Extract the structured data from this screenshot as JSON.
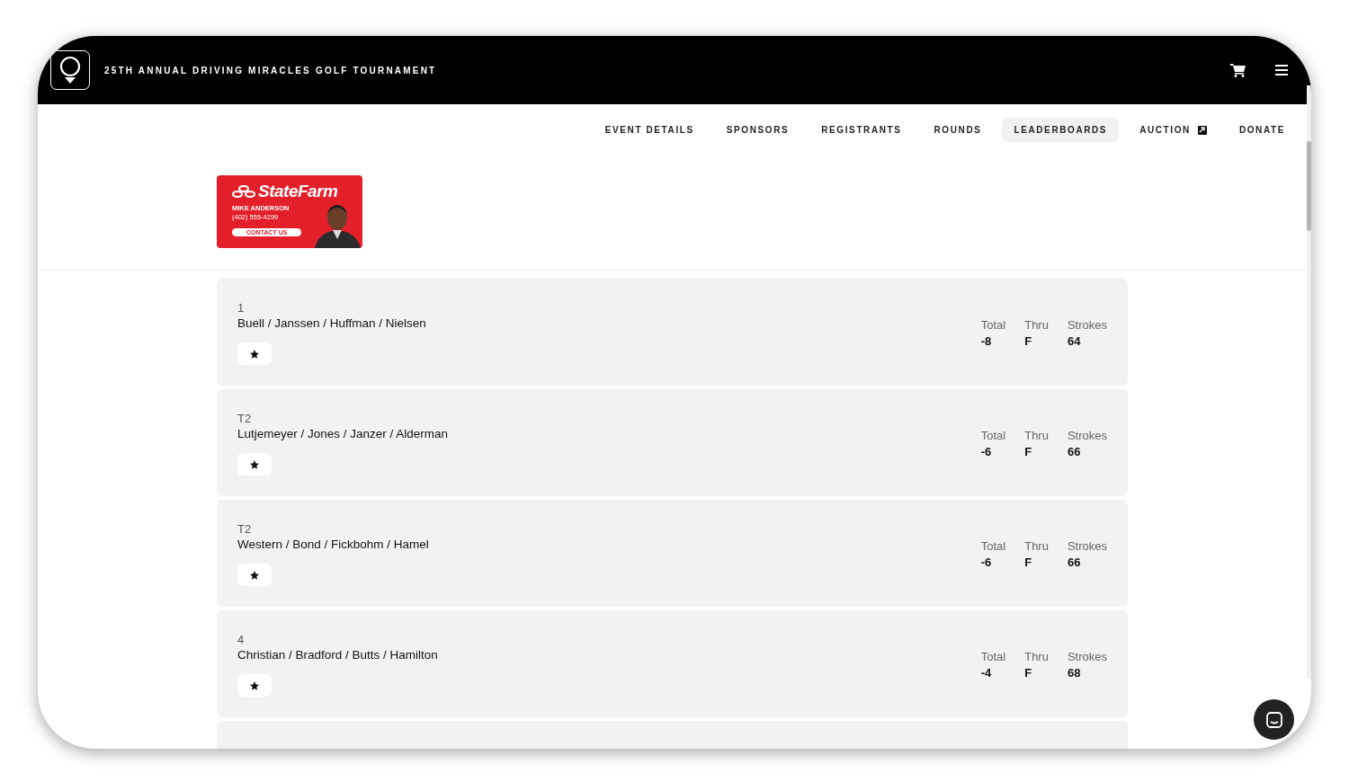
{
  "header": {
    "title": "25TH ANNUAL DRIVING MIRACLES GOLF TOURNAMENT"
  },
  "nav": [
    {
      "label": "EVENT DETAILS",
      "selected": false,
      "external": false
    },
    {
      "label": "SPONSORS",
      "selected": false,
      "external": false
    },
    {
      "label": "REGISTRANTS",
      "selected": false,
      "external": false
    },
    {
      "label": "ROUNDS",
      "selected": false,
      "external": false
    },
    {
      "label": "LEADERBOARDS",
      "selected": true,
      "external": false
    },
    {
      "label": "AUCTION",
      "selected": false,
      "external": true
    },
    {
      "label": "DONATE",
      "selected": false,
      "external": false
    }
  ],
  "sponsor_ad": {
    "brand": "StateFarm",
    "name": "MIKE ANDERSON",
    "phone": "(402) 555-4299",
    "button": "CONTACT US"
  },
  "leaderboard": [
    {
      "rank": "1",
      "team": "Buell / Janssen / Huffman / Nielsen",
      "favorite": true,
      "stats": [
        {
          "label": "Total",
          "value": "-8"
        },
        {
          "label": "Thru",
          "value": "F"
        },
        {
          "label": "Strokes",
          "value": "64"
        }
      ]
    },
    {
      "rank": "T2",
      "team": "Lutjemeyer / Jones / Janzer / Alderman",
      "favorite": true,
      "stats": [
        {
          "label": "Total",
          "value": "-6"
        },
        {
          "label": "Thru",
          "value": "F"
        },
        {
          "label": "Strokes",
          "value": "66"
        }
      ]
    },
    {
      "rank": "T2",
      "team": "Western / Bond / Fickbohm / Hamel",
      "favorite": true,
      "stats": [
        {
          "label": "Total",
          "value": "-6"
        },
        {
          "label": "Thru",
          "value": "F"
        },
        {
          "label": "Strokes",
          "value": "66"
        }
      ]
    },
    {
      "rank": "4",
      "team": "Christian / Bradford / Butts / Hamilton",
      "favorite": true,
      "stats": [
        {
          "label": "Total",
          "value": "-4"
        },
        {
          "label": "Thru",
          "value": "F"
        },
        {
          "label": "Strokes",
          "value": "68"
        }
      ]
    }
  ],
  "more_rows_below": true
}
